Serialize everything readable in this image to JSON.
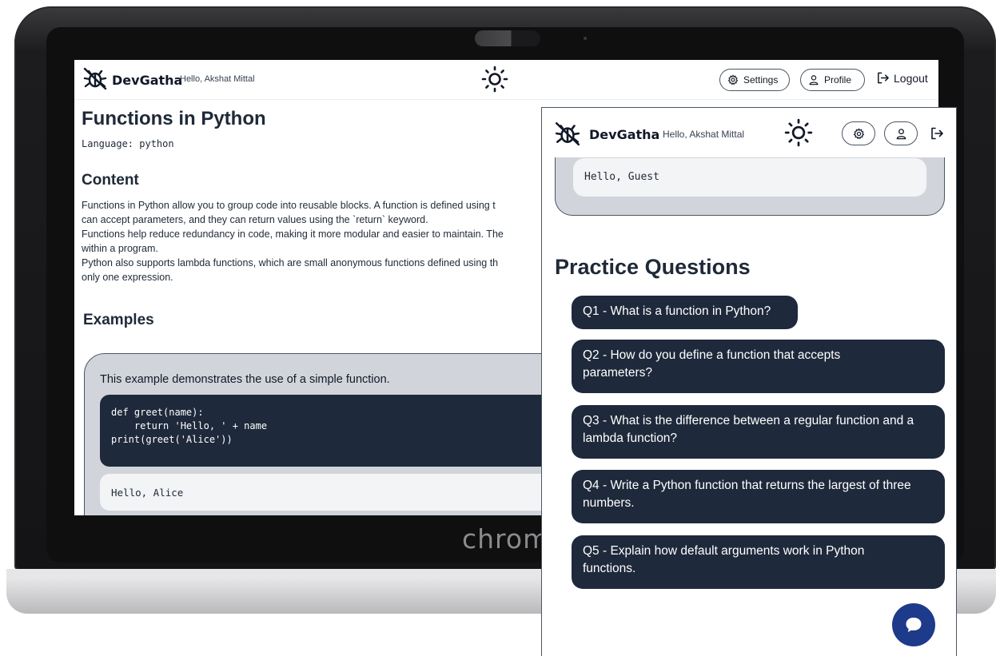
{
  "app": {
    "name": "DevGatha",
    "greeting": "Hello, Akshat Mittal"
  },
  "nav": {
    "settings_label": "Settings",
    "profile_label": "Profile",
    "logout_label": "Logout"
  },
  "lesson": {
    "title": "Functions in Python",
    "language_line": "Language: python",
    "content_heading": "Content",
    "content_lines": [
      "Functions in Python allow you to group code into reusable blocks. A function is defined using t",
      "can accept parameters, and they can return values using the `return` keyword.",
      "Functions help reduce redundancy in code, making it more modular and easier to maintain. The",
      "within a program.",
      "Python also supports lambda functions, which are small anonymous functions defined using th",
      "only one expression."
    ],
    "examples_heading": "Examples",
    "example": {
      "description": "This example demonstrates the use of a simple function.",
      "code": "def greet(name):\n    return 'Hello, ' + name\nprint(greet('Alice'))",
      "output": "Hello, Alice"
    }
  },
  "device": {
    "brand_text": "chrom"
  },
  "mobile": {
    "app_name": "DevGatha",
    "greeting": "Hello, Akshat Mittal",
    "previous_output": "Hello, Guest",
    "practice_heading": "Practice Questions",
    "questions": [
      "Q1 - What is a function in Python?",
      "Q2 - How do you define a function that accepts parameters?",
      "Q3 - What is the difference between a regular function and a lambda function?",
      "Q4 - Write a Python function that returns the largest of three numbers.",
      "Q5 - Explain how default arguments work in Python functions."
    ]
  },
  "icons": {
    "logo": "bug-icon",
    "theme": "sun-icon",
    "settings": "gear-icon",
    "profile": "user-icon",
    "logout": "logout-icon",
    "chat": "chat-bubble-icon"
  },
  "colors": {
    "button_dark": "#1e293b",
    "card_gray": "#d1d5db",
    "chat_fab": "#1e3a8a"
  }
}
